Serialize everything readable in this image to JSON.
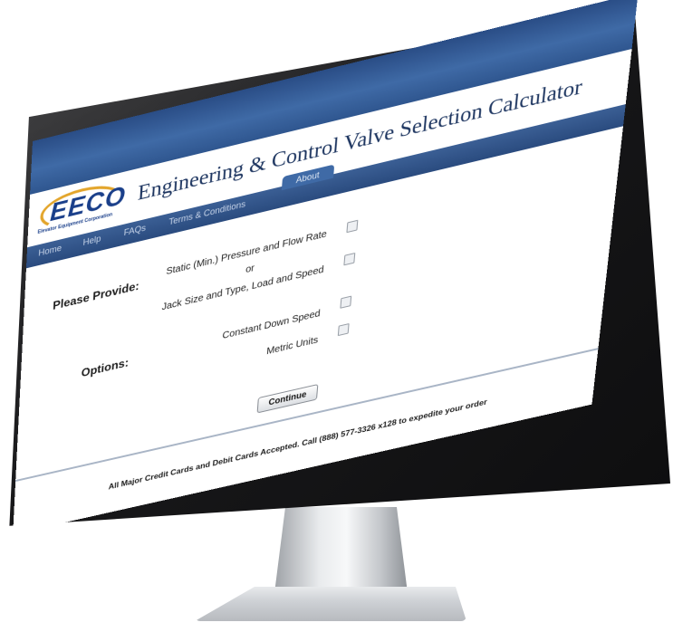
{
  "logo": {
    "word": "EECO",
    "subtitle": "Elevator Equipment Corporation"
  },
  "header": {
    "title": "Engineering & Control Valve Selection Calculator"
  },
  "nav": {
    "items": [
      "Home",
      "Help",
      "FAQs",
      "Terms & Conditions"
    ],
    "active": "About"
  },
  "form": {
    "provide_label": "Please Provide:",
    "options_label": "Options:",
    "provide_items": [
      "Static (Min.) Pressure and Flow Rate",
      "or",
      "Jack Size and Type, Load and Speed"
    ],
    "option_items": [
      "Constant Down Speed",
      "Metric Units"
    ],
    "continue_label": "Continue"
  },
  "footer": {
    "text": "All Major Credit Cards and Debit Cards Accepted.  Call (888) 577-3326  x128 to expedite your order"
  },
  "colors": {
    "brand_blue": "#2a4d86",
    "nav_blue": "#3b5f95",
    "logo_orange": "#e3a52b",
    "title_navy": "#1d3560"
  }
}
